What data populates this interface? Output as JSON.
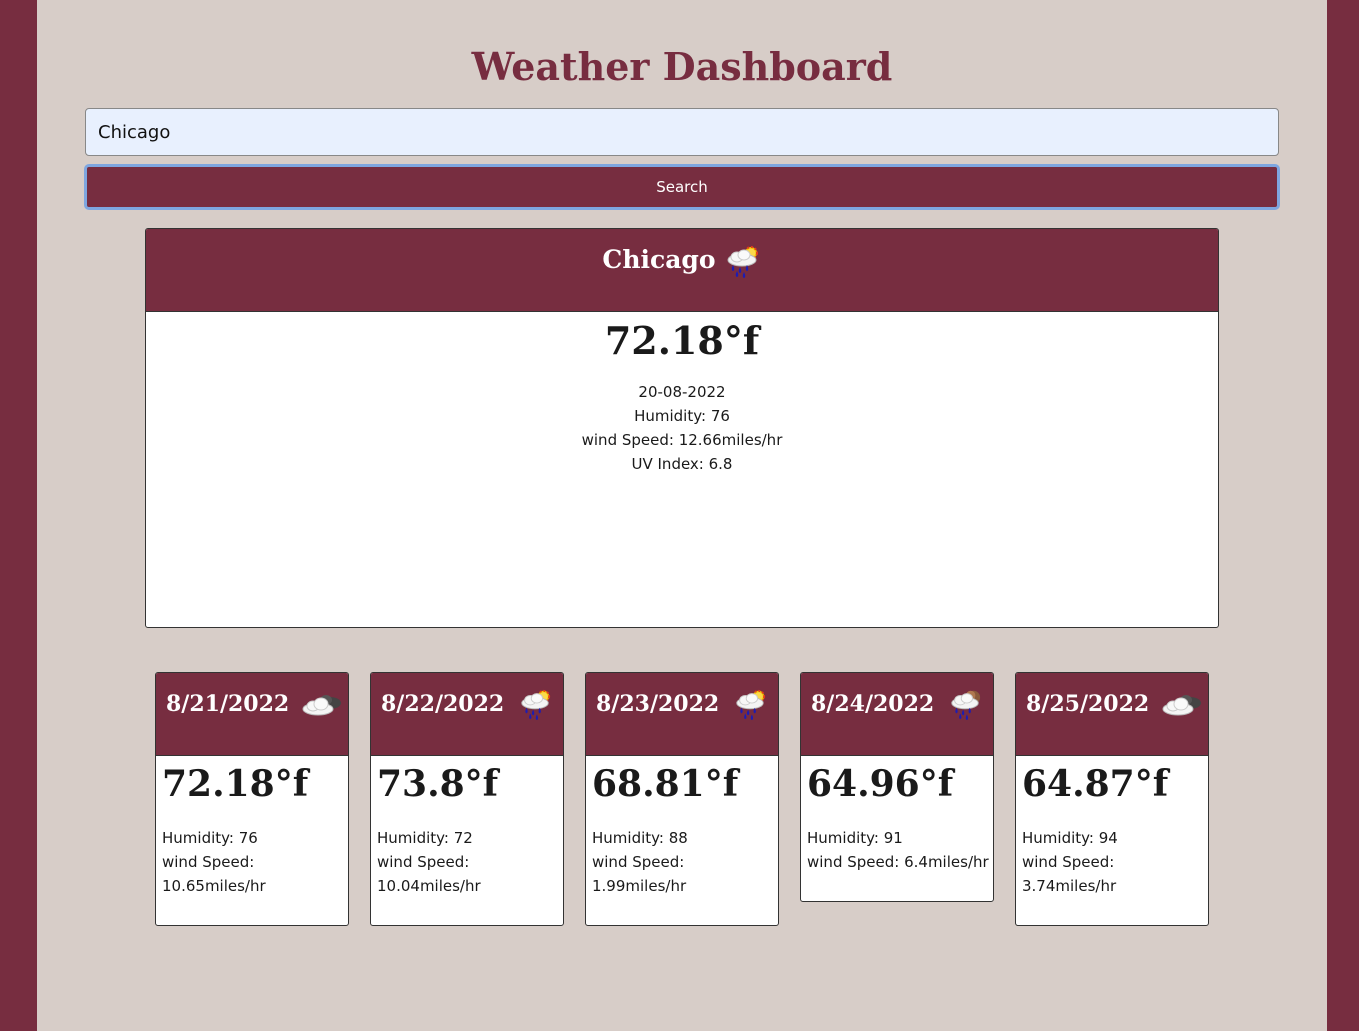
{
  "header": {
    "title": "Weather Dashboard"
  },
  "search": {
    "value": "Chicago",
    "button_label": "Search"
  },
  "current": {
    "city": "Chicago",
    "icon": "rain-sun-icon",
    "temperature": "72.18°f",
    "date": "20-08-2022",
    "humidity": "Humidity: 76",
    "wind": "wind Speed: 12.66miles/hr",
    "uv": "UV Index: 6.8"
  },
  "forecast": [
    {
      "date": "8/21/2022",
      "icon": "cloud-night-icon",
      "temperature": "72.18°f",
      "humidity": "Humidity: 76",
      "wind_label": "wind Speed:",
      "wind_value": "10.65miles/hr"
    },
    {
      "date": "8/22/2022",
      "icon": "rain-sun-icon",
      "temperature": "73.8°f",
      "humidity": "Humidity: 72",
      "wind_label": "wind Speed:",
      "wind_value": "10.04miles/hr"
    },
    {
      "date": "8/23/2022",
      "icon": "rain-sun-icon",
      "temperature": "68.81°f",
      "humidity": "Humidity: 88",
      "wind_label": "wind Speed:",
      "wind_value": "1.99miles/hr"
    },
    {
      "date": "8/24/2022",
      "icon": "rain-moon-icon",
      "temperature": "64.96°f",
      "humidity": "Humidity: 91",
      "wind_label": "wind Speed:",
      "wind_value": "6.4miles/hr"
    },
    {
      "date": "8/25/2022",
      "icon": "cloud-night-icon",
      "temperature": "64.87°f",
      "humidity": "Humidity: 94",
      "wind_label": "wind Speed:",
      "wind_value": "3.74miles/hr"
    }
  ],
  "colors": {
    "brand": "#772d40",
    "background": "#d7cdc8",
    "input_bg": "#e8f0fe",
    "focus_ring": "#7ea6e0"
  }
}
